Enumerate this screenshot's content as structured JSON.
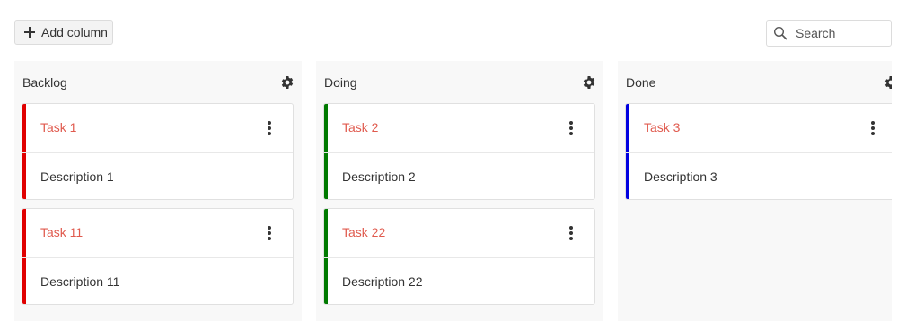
{
  "toolbar": {
    "add_column_label": "Add column",
    "search_placeholder": "Search"
  },
  "columns": [
    {
      "title": "Backlog",
      "cards": [
        {
          "title": "Task 1",
          "description": "Description 1",
          "color": "#e00000"
        },
        {
          "title": "Task 11",
          "description": "Description 11",
          "color": "#e00000"
        }
      ]
    },
    {
      "title": "Doing",
      "cards": [
        {
          "title": "Task 2",
          "description": "Description 2",
          "color": "#007a00"
        },
        {
          "title": "Task 22",
          "description": "Description 22",
          "color": "#007a00"
        }
      ]
    },
    {
      "title": "Done",
      "cards": [
        {
          "title": "Task 3",
          "description": "Description 3",
          "color": "#0000e0"
        }
      ]
    }
  ],
  "colors": {
    "card_title": "#e05a4e",
    "column_bg": "#f8f8f8"
  },
  "icons": {
    "add": "plus-icon",
    "search": "search-icon",
    "column_settings": "gear-icon",
    "card_menu": "kebab-menu-icon"
  }
}
